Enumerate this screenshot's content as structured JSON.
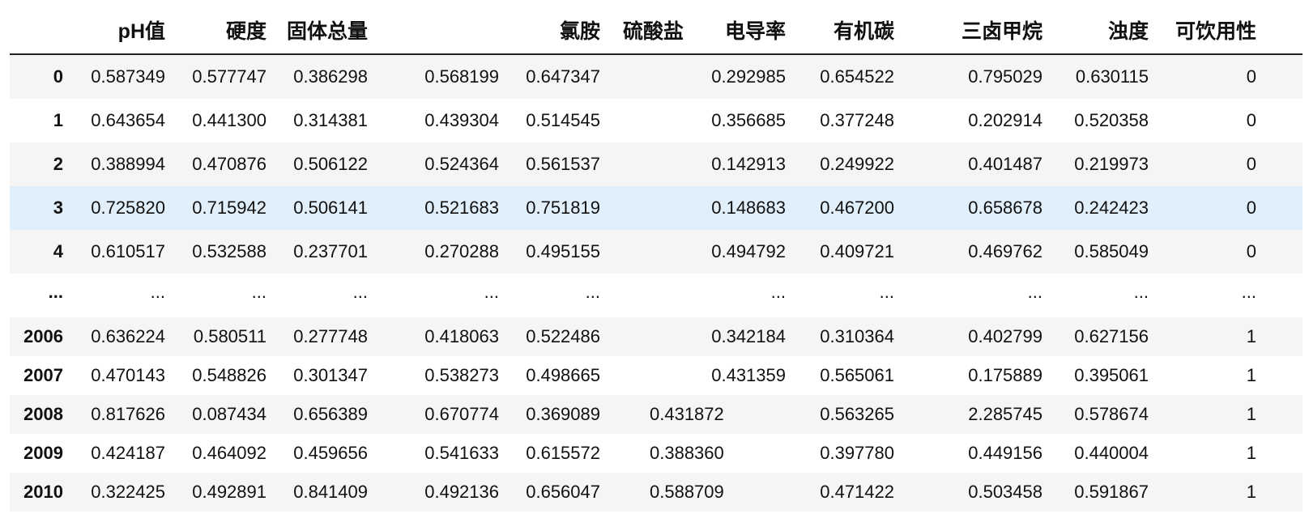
{
  "table": {
    "columns": [
      "pH值",
      "硬度",
      "固体总量",
      "氯胺",
      "硫酸盐",
      "电导率",
      "有机碳",
      "三卤甲烷",
      "浊度",
      "可饮用性"
    ],
    "rows": [
      {
        "index": "0",
        "values": [
          "0.587349",
          "0.577747",
          "0.386298",
          "0.568199",
          "0.647347",
          "",
          "0.292985",
          "0.654522",
          "0.795029",
          "0.630115",
          "0"
        ]
      },
      {
        "index": "1",
        "values": [
          "0.643654",
          "0.441300",
          "0.314381",
          "0.439304",
          "0.514545",
          "",
          "0.356685",
          "0.377248",
          "0.202914",
          "0.520358",
          "0"
        ]
      },
      {
        "index": "2",
        "values": [
          "0.388994",
          "0.470876",
          "0.506122",
          "0.524364",
          "0.561537",
          "",
          "0.142913",
          "0.249922",
          "0.401487",
          "0.219973",
          "0"
        ]
      },
      {
        "index": "3",
        "values": [
          "0.725820",
          "0.715942",
          "0.506141",
          "0.521683",
          "0.751819",
          "",
          "0.148683",
          "0.467200",
          "0.658678",
          "0.242423",
          "0"
        ]
      },
      {
        "index": "4",
        "values": [
          "0.610517",
          "0.532588",
          "0.237701",
          "0.270288",
          "0.495155",
          "",
          "0.494792",
          "0.409721",
          "0.469762",
          "0.585049",
          "0"
        ]
      },
      {
        "index": "...",
        "values": [
          "...",
          "...",
          "...",
          "...",
          "...",
          "",
          "...",
          "...",
          "...",
          "...",
          "..."
        ]
      },
      {
        "index": "2006",
        "values": [
          "0.636224",
          "0.580511",
          "0.277748",
          "0.418063",
          "0.522486",
          "",
          "0.342184",
          "0.310364",
          "0.402799",
          "0.627156",
          "1"
        ]
      },
      {
        "index": "2007",
        "values": [
          "0.470143",
          "0.548826",
          "0.301347",
          "0.538273",
          "0.498665",
          "",
          "0.431359",
          "0.565061",
          "0.175889",
          "0.395061",
          "1"
        ]
      },
      {
        "index": "2008",
        "values": [
          "0.817626",
          "0.087434",
          "0.656389",
          "0.670774",
          "0.369089",
          "0.431872",
          "",
          "0.563265",
          "2.285745",
          "0.578674",
          "1"
        ]
      },
      {
        "index": "2009",
        "values": [
          "0.424187",
          "0.464092",
          "0.459656",
          "0.541633",
          "0.615572",
          "0.388360",
          "",
          "0.397780",
          "0.449156",
          "0.440004",
          "1"
        ]
      },
      {
        "index": "2010",
        "values": [
          "0.322425",
          "0.492891",
          "0.841409",
          "0.492136",
          "0.656047",
          "0.588709",
          "",
          "0.471422",
          "0.503458",
          "0.591867",
          "1"
        ]
      }
    ],
    "colors": {
      "alt_row": "#f5f5f5",
      "hover_row": "#e1effb",
      "header_rule": "#222222"
    }
  }
}
